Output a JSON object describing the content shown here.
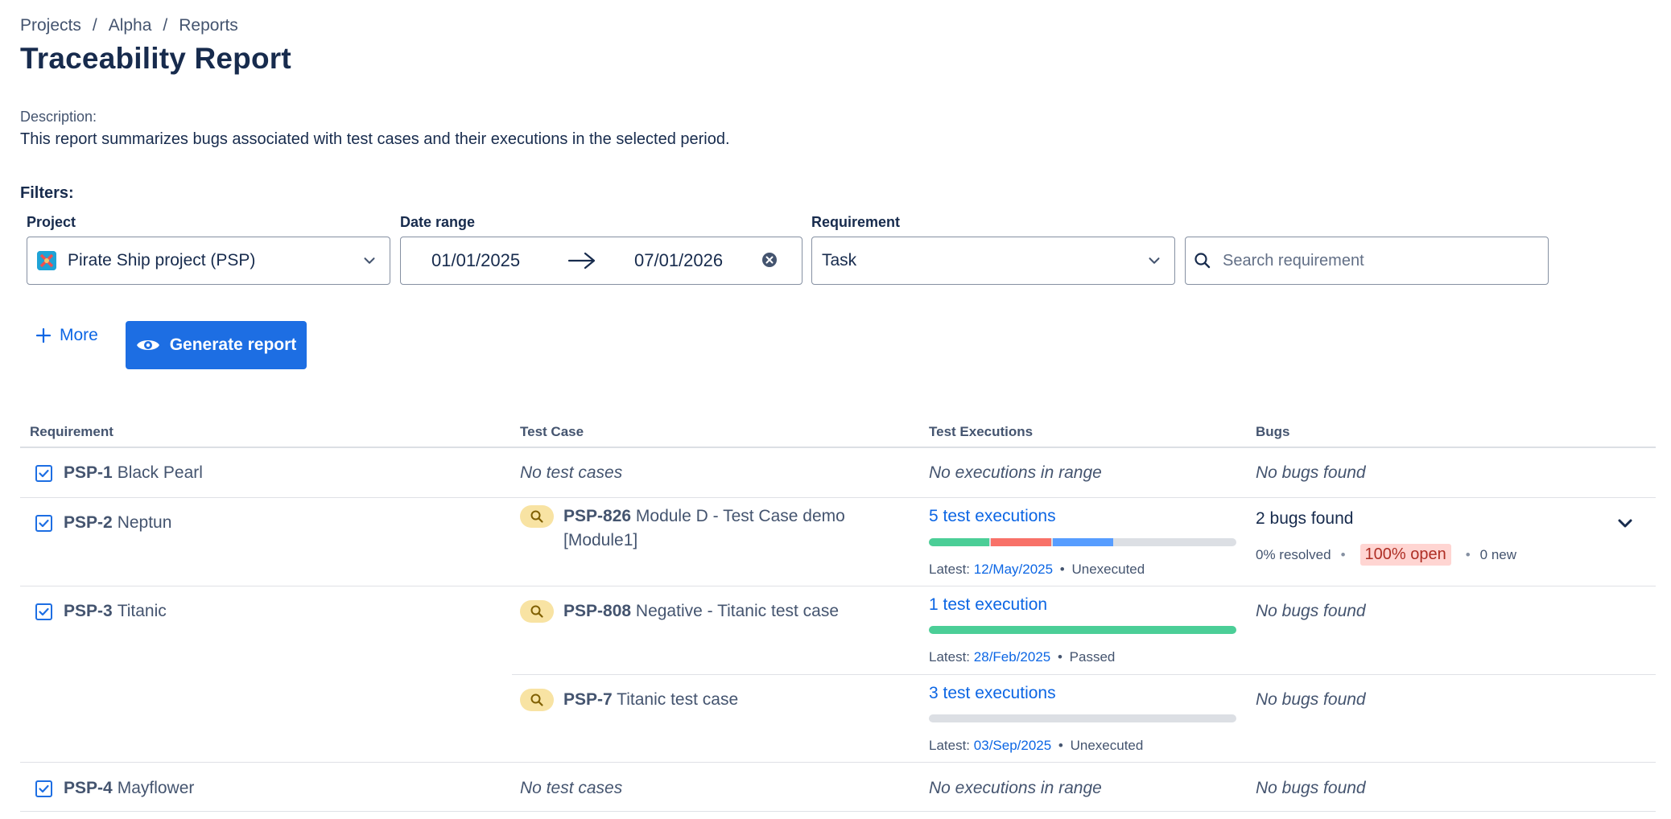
{
  "breadcrumb": [
    "Projects",
    "Alpha",
    "Reports"
  ],
  "page_title": "Traceability Report",
  "description": {
    "label": "Description:",
    "text": "This report summarizes bugs associated with test cases and their executions in the selected period."
  },
  "filters": {
    "label": "Filters:",
    "project": {
      "label": "Project",
      "value": "Pirate Ship project (PSP)"
    },
    "date_range": {
      "label": "Date range",
      "start": "01/01/2025",
      "end": "07/01/2026"
    },
    "requirement": {
      "label": "Requirement",
      "value": "Task"
    },
    "search": {
      "placeholder": "Search requirement"
    }
  },
  "actions": {
    "more_label": "More",
    "generate_label": "Generate report"
  },
  "table": {
    "headers": [
      "Requirement",
      "Test Case",
      "Test Executions",
      "Bugs"
    ],
    "rows": [
      {
        "req_key": "PSP-1",
        "req_name": "Black Pearl",
        "test_case": "No test cases",
        "executions": "No executions in range",
        "bugs": "No bugs found"
      },
      {
        "req_key": "PSP-2",
        "req_name": "Neptun",
        "tc_key": "PSP-826",
        "tc_name": "Module D - Test Case demo",
        "tc_name2": "[Module1]",
        "exec_link": "5 test executions",
        "latest_label": "Latest:",
        "latest_date": "12/May/2025",
        "latest_status": "Unexecuted",
        "bugs_found": "2 bugs found",
        "resolved": "0% resolved",
        "open": "100% open",
        "new": "0 new"
      },
      {
        "req_key": "PSP-3",
        "req_name": "Titanic",
        "tc_key": "PSP-808",
        "tc_name": "Negative - Titanic test case",
        "exec_link": "1 test execution",
        "latest_label": "Latest:",
        "latest_date": "28/Feb/2025",
        "latest_status": "Passed",
        "bugs": "No bugs found"
      },
      {
        "tc_key": "PSP-7",
        "tc_name": "Titanic test case",
        "exec_link": "3 test executions",
        "latest_label": "Latest:",
        "latest_date": "03/Sep/2025",
        "latest_status": "Unexecuted",
        "bugs": "No bugs found"
      },
      {
        "req_key": "PSP-4",
        "req_name": "Mayflower",
        "test_case": "No test cases",
        "executions": "No executions in range",
        "bugs": "No bugs found"
      }
    ]
  },
  "colors": {
    "passed": "#4bce97",
    "failed": "#f87168",
    "in_progress": "#579dff",
    "unexecuted": "#dcdfe4",
    "accent": "#1d6ee3"
  },
  "icons": [
    "checkbox-checked-icon",
    "search-icon",
    "chevron-down-icon",
    "arrow-right-icon",
    "clear-icon",
    "plus-icon",
    "eye-icon",
    "test-case-search-icon"
  ]
}
